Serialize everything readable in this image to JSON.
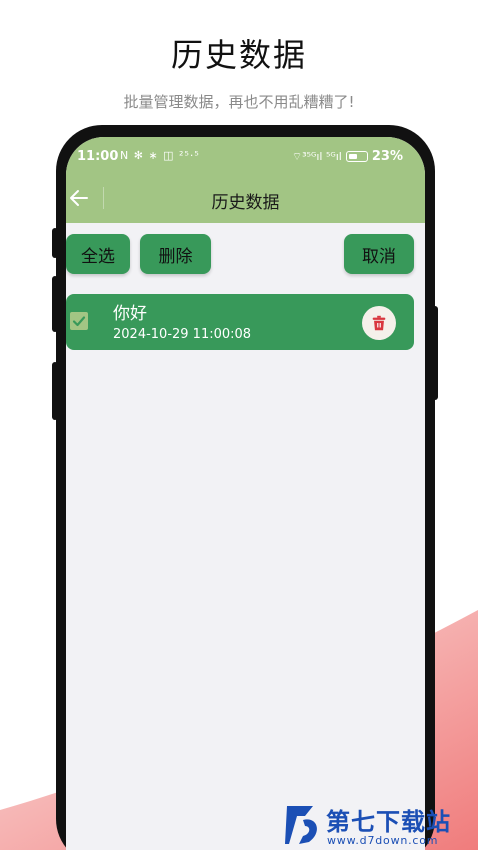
{
  "promo": {
    "title": "历史数据",
    "subtitle": "批量管理数据，再也不用乱糟糟了!"
  },
  "status_bar": {
    "time": "11:00",
    "left_icons": "N ✻ ∗ ◫ ²⁵·⁵",
    "right_icons": "⌔³⁵ᴳıl ⁵ᴳıl",
    "battery_percent": "23%"
  },
  "app_bar": {
    "title": "历史数据",
    "back_icon": "arrow-left-icon",
    "background_color": "#a2c584"
  },
  "toolbar": {
    "select_all_label": "全选",
    "delete_label": "删除",
    "cancel_label": "取消",
    "button_color": "#38995a"
  },
  "records": [
    {
      "title": "你好",
      "timestamp": "2024-10-29 11:00:08",
      "checked": true,
      "delete_icon": "trash-icon"
    }
  ],
  "watermark": {
    "brand": "第七下载站",
    "url": "www.d7down.com"
  },
  "colors": {
    "accent_green": "#38995a",
    "light_green": "#a2c584",
    "trash_red": "#d9363e",
    "brand_blue": "#1b4fb5"
  }
}
